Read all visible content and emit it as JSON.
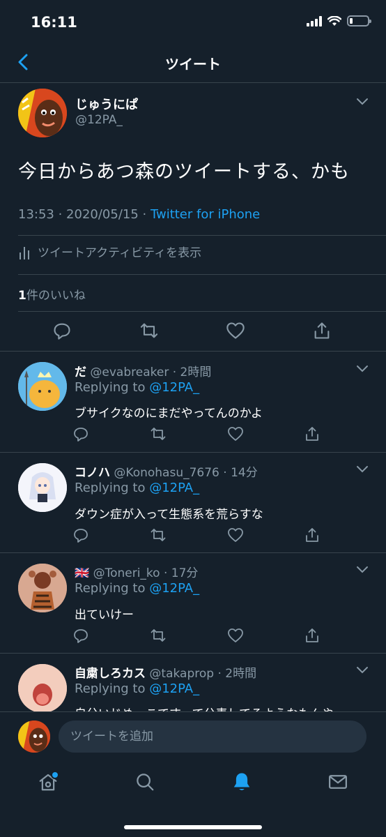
{
  "status_bar": {
    "time": "16:11"
  },
  "nav": {
    "title": "ツイート"
  },
  "tweet": {
    "display_name": "じゅうにぱ",
    "handle": "@12PA_",
    "text": "今日からあつ森のツイートする、かも",
    "time": "13:53 · 2020/05/15 · ",
    "source": "Twitter for iPhone",
    "activity_label": "ツイートアクティビティを表示",
    "likes_count": "1",
    "likes_label": "件のいいね"
  },
  "replies": [
    {
      "name": "だ",
      "handle": "@evabreaker",
      "time": "· 2時間",
      "replying_prefix": "Replying to ",
      "replying_to": "@12PA_",
      "text": "ブサイクなのにまだやってんのかよ"
    },
    {
      "name": "コノハ",
      "handle": "@Konohasu_7676",
      "time": "· 14分",
      "replying_prefix": "Replying to ",
      "replying_to": "@12PA_",
      "text": "ダウン症が入って生態系を荒らすな"
    },
    {
      "name": "🇬🇧",
      "handle": "@Toneri_ko",
      "time": "· 17分",
      "replying_prefix": "Replying to ",
      "replying_to": "@12PA_",
      "text": "出ていけー"
    },
    {
      "name": "自粛しろカス",
      "handle": "@takaprop",
      "time": "· 2時間",
      "replying_prefix": "Replying to ",
      "replying_to": "@12PA_",
      "text": "自分いじめっこですって公表してるようなもんや"
    }
  ],
  "compose": {
    "placeholder": "ツイートを追加"
  },
  "icons": {
    "back": "chevron-left-icon",
    "reply": "reply-icon",
    "retweet": "retweet-icon",
    "like": "heart-icon",
    "share": "share-icon",
    "home": "home-icon",
    "search": "search-icon",
    "notifications": "bell-icon",
    "messages": "mail-icon"
  },
  "colors": {
    "background": "#15202b",
    "accent": "#1da1f2",
    "secondary_text": "#8899a6",
    "divider": "#38444d"
  }
}
